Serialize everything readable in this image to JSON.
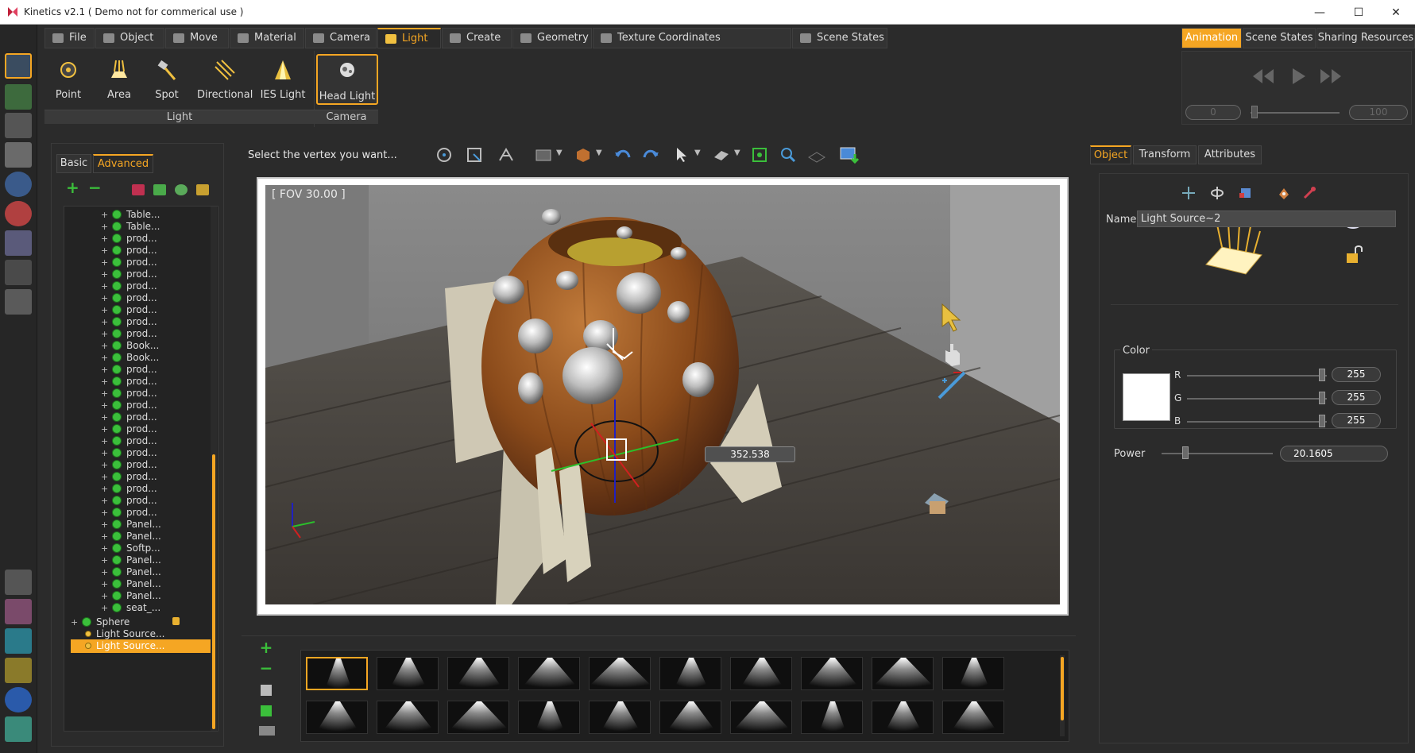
{
  "window": {
    "title": "Kinetics v2.1 ( Demo not for commerical use )",
    "minimize": "—",
    "maximize": "☐",
    "close": "✕"
  },
  "ribbon": {
    "tabs": [
      {
        "label": "File"
      },
      {
        "label": "Object"
      },
      {
        "label": "Move"
      },
      {
        "label": "Material"
      },
      {
        "label": "Camera"
      },
      {
        "label": "Light"
      },
      {
        "label": "Create"
      },
      {
        "label": "Geometry"
      },
      {
        "label": "Texture Coordinates"
      },
      {
        "label": "Scene States"
      }
    ],
    "active_tab": "Light",
    "light_tools": [
      {
        "label": "Point",
        "icon": "point-light-icon"
      },
      {
        "label": "Area",
        "icon": "area-light-icon"
      },
      {
        "label": "Spot",
        "icon": "spot-light-icon"
      },
      {
        "label": "Directional",
        "icon": "directional-light-icon"
      },
      {
        "label": "IES Light",
        "icon": "ies-light-icon"
      }
    ],
    "camera_tools": [
      {
        "label": "Head Light",
        "icon": "head-light-icon"
      }
    ],
    "groups": {
      "light": "Light",
      "camera": "Camera"
    }
  },
  "animation_panel": {
    "tabs": [
      {
        "label": "Animation"
      },
      {
        "label": "Scene States"
      },
      {
        "label": "Sharing Resources"
      }
    ],
    "active_tab": "Animation",
    "frame_start": "0",
    "frame_end": "100"
  },
  "outliner": {
    "tabs": [
      {
        "label": "Basic"
      },
      {
        "label": "Advanced"
      }
    ],
    "active_tab": "Advanced",
    "items": [
      {
        "label": "Table..."
      },
      {
        "label": "Table..."
      },
      {
        "label": "prod..."
      },
      {
        "label": "prod..."
      },
      {
        "label": "prod..."
      },
      {
        "label": "prod..."
      },
      {
        "label": "prod..."
      },
      {
        "label": "prod..."
      },
      {
        "label": "prod..."
      },
      {
        "label": "prod..."
      },
      {
        "label": "prod..."
      },
      {
        "label": "Book..."
      },
      {
        "label": "Book..."
      },
      {
        "label": "prod..."
      },
      {
        "label": "prod..."
      },
      {
        "label": "prod..."
      },
      {
        "label": "prod..."
      },
      {
        "label": "prod..."
      },
      {
        "label": "prod..."
      },
      {
        "label": "prod..."
      },
      {
        "label": "prod..."
      },
      {
        "label": "prod..."
      },
      {
        "label": "prod..."
      },
      {
        "label": "prod..."
      },
      {
        "label": "prod..."
      },
      {
        "label": "prod..."
      },
      {
        "label": "Panel..."
      },
      {
        "label": "Panel..."
      },
      {
        "label": "Softp..."
      },
      {
        "label": "Panel..."
      },
      {
        "label": "Panel..."
      },
      {
        "label": "Panel..."
      },
      {
        "label": "Panel..."
      },
      {
        "label": "seat_..."
      }
    ],
    "root_items": [
      {
        "label": "Sphere"
      },
      {
        "label": "Light Source..."
      },
      {
        "label": "Light Source..."
      }
    ]
  },
  "viewport": {
    "message": "Select the vertex you want...",
    "fov": "[ FOV 30.00 ]",
    "value_readout": "352.538"
  },
  "properties": {
    "tabs": [
      {
        "label": "Object"
      },
      {
        "label": "Transform"
      },
      {
        "label": "Attributes"
      }
    ],
    "active_tab": "Object",
    "name_label": "Name",
    "name_value": "Light Source~2",
    "color_group": "Color",
    "channels": [
      {
        "label": "R",
        "value": "255"
      },
      {
        "label": "G",
        "value": "255"
      },
      {
        "label": "B",
        "value": "255"
      }
    ],
    "color_hex": "#ffffff",
    "power_label": "Power",
    "power_value": "20.1605"
  },
  "colors": {
    "accent": "#f5a623",
    "panel": "#2b2b2b",
    "add_green": "#3bbf3b"
  }
}
